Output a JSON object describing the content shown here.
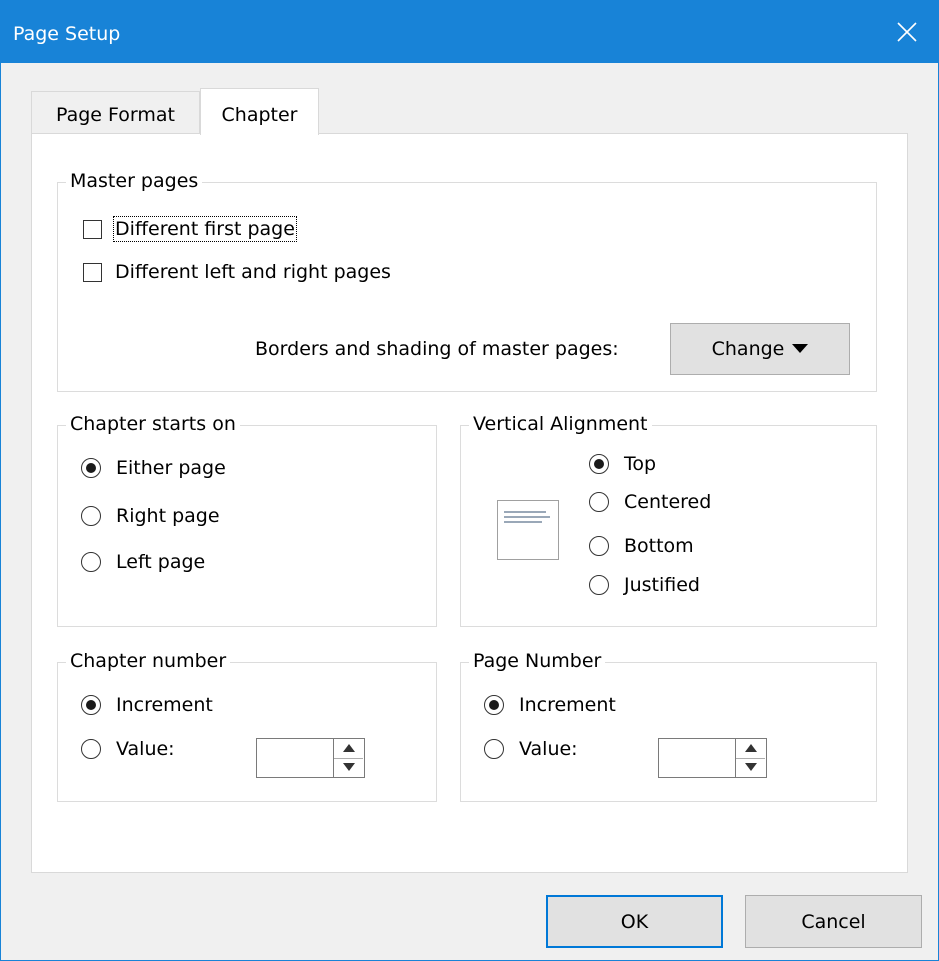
{
  "window": {
    "title": "Page Setup"
  },
  "tabs": [
    {
      "label": "Page Format",
      "active": false
    },
    {
      "label": "Chapter",
      "active": true
    }
  ],
  "master_pages": {
    "title": "Master pages",
    "different_first_page": {
      "label": "Different first page",
      "checked": false
    },
    "different_left_right": {
      "label": "Different left and right pages",
      "checked": false
    },
    "borders_label": "Borders and shading of master pages:",
    "change_button": "Change"
  },
  "chapter_starts_on": {
    "title": "Chapter starts on",
    "options": [
      {
        "label": "Either page",
        "selected": true
      },
      {
        "label": "Right page",
        "selected": false
      },
      {
        "label": "Left page",
        "selected": false
      }
    ]
  },
  "vertical_alignment": {
    "title": "Vertical Alignment",
    "options": [
      {
        "label": "Top",
        "selected": true
      },
      {
        "label": "Centered",
        "selected": false
      },
      {
        "label": "Bottom",
        "selected": false
      },
      {
        "label": "Justified",
        "selected": false
      }
    ]
  },
  "chapter_number": {
    "title": "Chapter number",
    "increment": {
      "label": "Increment",
      "selected": true
    },
    "value": {
      "label": "Value:",
      "selected": false,
      "field_value": ""
    }
  },
  "page_number": {
    "title": "Page Number",
    "increment": {
      "label": "Increment",
      "selected": true
    },
    "value": {
      "label": "Value:",
      "selected": false,
      "field_value": ""
    }
  },
  "footer": {
    "ok": "OK",
    "cancel": "Cancel"
  },
  "colors": {
    "titlebar": "#1883d7",
    "default_button_border": "#0078d7"
  }
}
